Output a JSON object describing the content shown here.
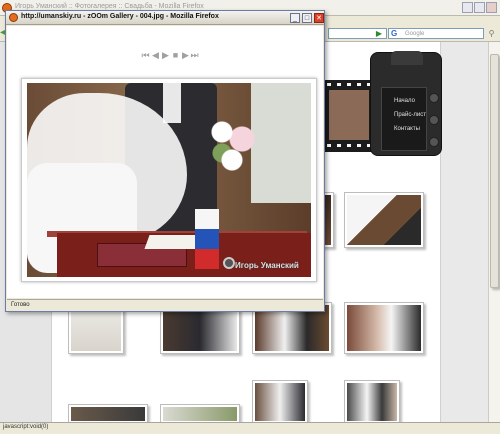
{
  "background_window": {
    "title": "Игорь Уманский :: Фотогалерея :: Свадьба - Mozilla Firefox",
    "search_placeholder": "Google",
    "status_text": "javascript:void(0)"
  },
  "camera_menu": {
    "items": [
      "Начало",
      "Прайс-лист",
      "Контакты"
    ]
  },
  "popup_window": {
    "title": "http://umanskiy.ru - zOOm Gallery - 004.jpg - Mozilla Firefox",
    "status_text": "Готово",
    "controls": [
      "first-icon",
      "prev-icon",
      "play-icon",
      "stop-icon",
      "next-icon",
      "last-icon"
    ],
    "watermark": "Игорь Уманский"
  },
  "colors": {
    "popup_close": "#d9412b",
    "window_border": "#6b7ba8",
    "chrome": "#ece9d8"
  }
}
